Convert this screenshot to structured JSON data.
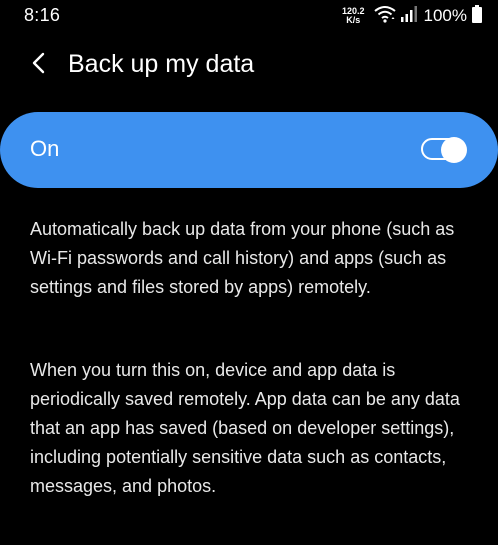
{
  "status_bar": {
    "time": "8:16",
    "net_speed_value": "120.2",
    "net_speed_unit": "K/s",
    "battery_percent": "100%"
  },
  "header": {
    "title": "Back up my data",
    "back_icon": "chevron-left-icon"
  },
  "toggle": {
    "label": "On",
    "state": "on",
    "accent_color": "#3e91f0"
  },
  "description": {
    "paragraph_1": "Automatically back up data from your phone (such as Wi-Fi passwords and call history) and apps (such as settings and files stored by apps) remotely.",
    "paragraph_2": "When you turn this on, device and app data is periodically saved remotely. App data can be any data that an app has saved (based on developer settings), including potentially sensitive data such as contacts, messages, and photos."
  }
}
